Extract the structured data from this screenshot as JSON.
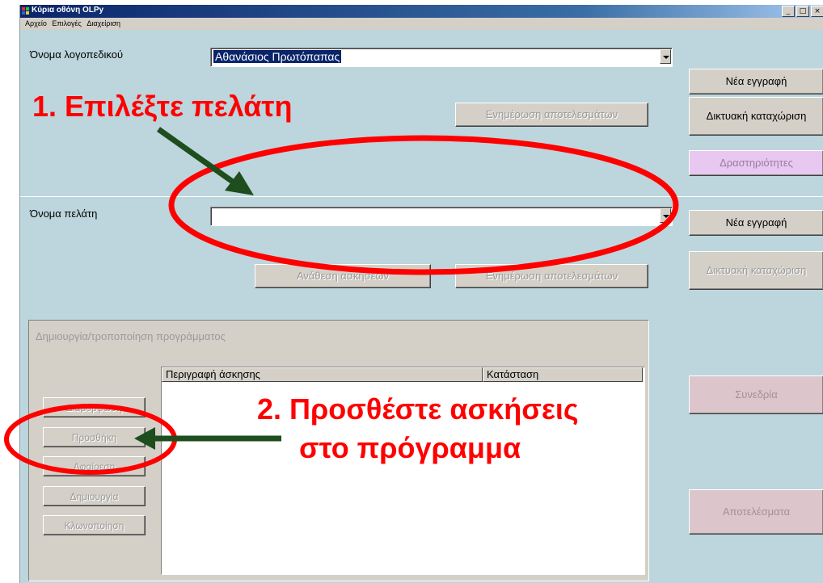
{
  "window": {
    "title": "Κύρια οθόνη OLPy",
    "controls": [
      "_",
      "□",
      "×"
    ]
  },
  "menu": [
    "Αρχείο",
    "Επιλογές",
    "Διαχείριση"
  ],
  "therapist": {
    "label": "Όνομα λογοπεδικού",
    "value": "Αθανάσιος Πρωτόπαπας",
    "update_results": "Ενημέρωση αποτελεσμάτων"
  },
  "client": {
    "label": "Όνομα πελάτη",
    "value": "",
    "assign_exercises": "Ανάθεση ασκήσεων",
    "update_results": "Ενημέρωση αποτελεσμάτων"
  },
  "right_panel": {
    "new_record_1": "Νέα εγγραφή",
    "online_registration_1": "Δικτυακή καταχώριση",
    "activities": "Δραστηριότητες",
    "new_record_2": "Νέα εγγραφή",
    "online_registration_2": "Δικτυακή καταχώριση",
    "session": "Συνεδρία",
    "results": "Αποτελέσματα"
  },
  "program_group": {
    "title": "Δημιουργία/τροποποίηση προγράμματος",
    "buttons": {
      "modify": "Διαμόρφωση",
      "add": "Προσθήκη",
      "remove": "Αφαίρεση",
      "create": "Δημιουργία",
      "clone": "Κλωνοποίηση"
    },
    "columns": [
      "Περιγραφή άσκησης",
      "Κατάσταση"
    ]
  },
  "annotations": {
    "step1": "1. Επιλέξτε πελάτη",
    "step2_line1": "2. Προσθέστε ασκήσεις",
    "step2_line2": "στο πρόγραμμα"
  },
  "colors": {
    "window_bg": "#bdd5dc",
    "annotation_red": "#ff0000",
    "arrow_green": "#1e4d1e",
    "selection_blue": "#0a246a"
  }
}
